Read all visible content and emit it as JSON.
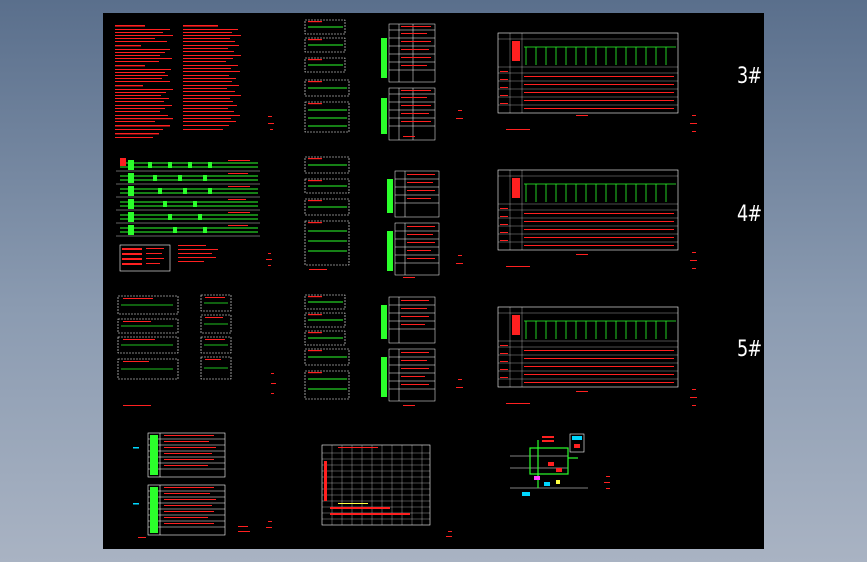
{
  "window": {
    "background_top": "#5a6f8c",
    "background_bottom": "#a9b3c3",
    "canvas_color": "#000000"
  },
  "colors": {
    "red": "#ff2020",
    "green": "#2bff2b",
    "white": "#ffffff",
    "cyan": "#00d8ff",
    "yellow": "#ffff40",
    "magenta": "#ff40ff"
  },
  "floors": [
    {
      "label": "3#"
    },
    {
      "label": "4#"
    },
    {
      "label": "5#"
    }
  ]
}
